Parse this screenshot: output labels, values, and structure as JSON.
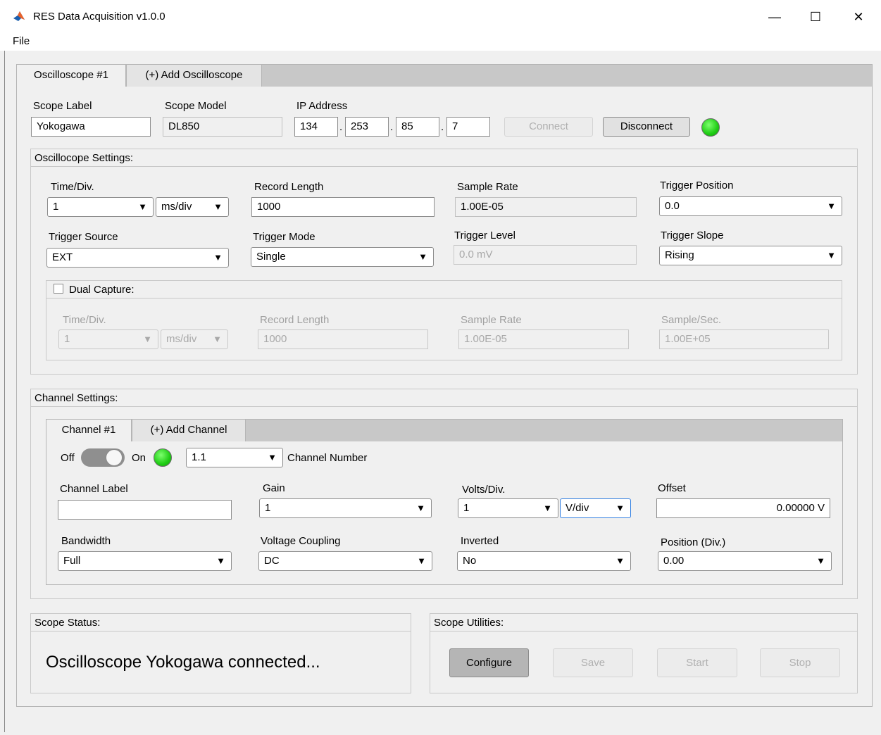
{
  "window": {
    "title": "RES Data Acquisition v1.0.0",
    "minimize": "—",
    "maximize": "☐",
    "close": "✕"
  },
  "menu": {
    "file": "File"
  },
  "scope_tabs": [
    "Oscilloscope #1",
    "(+) Add Oscilloscope"
  ],
  "connection": {
    "scope_label_label": "Scope Label",
    "scope_label_value": "Yokogawa",
    "scope_model_label": "Scope Model",
    "scope_model_value": "DL850",
    "ip_label": "IP Address",
    "ip": [
      "134",
      "253",
      "85",
      "7"
    ],
    "ip_dot": ".",
    "connect": "Connect",
    "disconnect": "Disconnect",
    "led_color": "#1fcc14"
  },
  "osc_settings": {
    "title": "Oscillocope Settings:",
    "time_div_label": "Time/Div.",
    "time_div_value": "1",
    "time_div_unit": "ms/div",
    "record_length_label": "Record Length",
    "record_length_value": "1000",
    "sample_rate_label": "Sample Rate",
    "sample_rate_value": "1.00E-05",
    "trigger_position_label": "Trigger Position",
    "trigger_position_value": "0.0",
    "trigger_source_label": "Trigger Source",
    "trigger_source_value": "EXT",
    "trigger_mode_label": "Trigger Mode",
    "trigger_mode_value": "Single",
    "trigger_level_label": "Trigger Level",
    "trigger_level_value": "0.0 mV",
    "trigger_slope_label": "Trigger Slope",
    "trigger_slope_value": "Rising"
  },
  "dual_capture": {
    "title": "Dual Capture:",
    "checked": false,
    "time_div_label": "Time/Div.",
    "time_div_value": "1",
    "time_div_unit": "ms/div",
    "record_length_label": "Record Length",
    "record_length_value": "1000",
    "sample_rate_label": "Sample Rate",
    "sample_rate_value": "1.00E-05",
    "sample_sec_label": "Sample/Sec.",
    "sample_sec_value": "1.00E+05"
  },
  "channel_settings": {
    "title": "Channel Settings:",
    "tabs": [
      "Channel #1",
      "(+) Add Channel"
    ],
    "off_label": "Off",
    "on_label": "On",
    "toggle_on": true,
    "channel_number_value": "1.1",
    "channel_number_label": "Channel Number",
    "channel_label_label": "Channel Label",
    "channel_label_value": "",
    "gain_label": "Gain",
    "gain_value": "1",
    "volts_div_label": "Volts/Div.",
    "volts_div_value": "1",
    "volts_div_unit": "V/div",
    "offset_label": "Offset",
    "offset_value": "0.00000 V",
    "bandwidth_label": "Bandwidth",
    "bandwidth_value": "Full",
    "coupling_label": "Voltage Coupling",
    "coupling_value": "DC",
    "inverted_label": "Inverted",
    "inverted_value": "No",
    "position_label": "Position (Div.)",
    "position_value": "0.00"
  },
  "status": {
    "title": "Scope Status:",
    "message": "Oscilloscope Yokogawa connected..."
  },
  "utilities": {
    "title": "Scope Utilities:",
    "configure": "Configure",
    "save": "Save",
    "start": "Start",
    "stop": "Stop"
  },
  "icons": {
    "dropdown": "▼"
  }
}
